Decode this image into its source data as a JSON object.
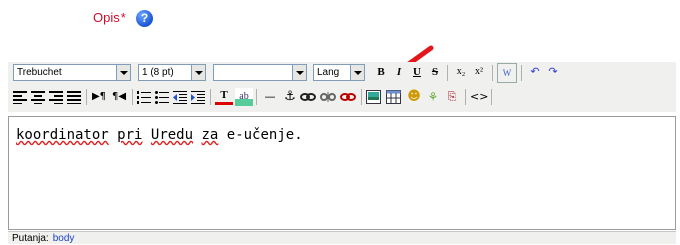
{
  "field": {
    "label": "Opis",
    "required_mark": "*",
    "help_icon": "help-icon"
  },
  "toolbar": {
    "font_family": "Trebuchet",
    "font_size": "1 (8 pt)",
    "format": "",
    "lang": "Lang",
    "buttons_row1": [
      {
        "name": "bold-button",
        "glyph": "B"
      },
      {
        "name": "italic-button",
        "glyph": "I"
      },
      {
        "name": "underline-button",
        "glyph": "U"
      },
      {
        "name": "strikethrough-button",
        "glyph": "S"
      },
      {
        "name": "subscript-button",
        "glyph": "x₂"
      },
      {
        "name": "superscript-button",
        "glyph": "x²"
      },
      {
        "name": "clean-word-button",
        "glyph": "W"
      },
      {
        "name": "undo-button",
        "glyph": "↶"
      },
      {
        "name": "redo-button",
        "glyph": "↷"
      }
    ],
    "buttons_row2": [
      "align-left-icon",
      "align-center-icon",
      "align-right-icon",
      "justify-icon",
      "ltr-icon",
      "rtl-icon",
      "ordered-list-icon",
      "unordered-list-icon",
      "outdent-icon",
      "indent-icon",
      "text-color-icon",
      "background-color-icon",
      "horizontal-rule-icon",
      "anchor-icon",
      "link-icon",
      "unlink-icon",
      "nolink-icon",
      "image-icon",
      "table-icon",
      "smiley-icon",
      "special-char-icon",
      "search-replace-icon",
      "html-source-icon"
    ]
  },
  "editor": {
    "text_word1": "koordinator",
    "text_space1": " ",
    "text_word2": "pri",
    "text_space2": " ",
    "text_word3": "Uredu",
    "text_space3": " ",
    "text_word4": "za",
    "text_rest": " e-učenje."
  },
  "status": {
    "label": "Putanja:",
    "path": "body"
  },
  "colors": {
    "label": "#c8102e",
    "toolbar_bg": "#f0f0ee",
    "arrow": "#e3161b",
    "status_link": "#1a3fcf"
  }
}
